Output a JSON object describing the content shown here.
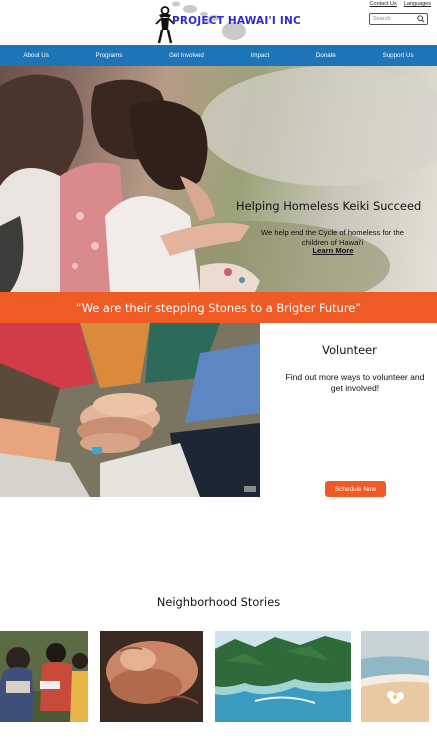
{
  "header": {
    "logo_text": "PROJECT HAWAI'I INC",
    "top_links": [
      "Contact Us",
      "Languages"
    ],
    "search_placeholder": "Search"
  },
  "nav": {
    "items": [
      "About Us",
      "Programs",
      "Get Involved",
      "Impact",
      "Donate",
      "Support Us"
    ]
  },
  "hero": {
    "title": "Helping Homeless Keiki Succeed",
    "subtitle": "We help end the Cycle of homeless for the children of Hawai'i",
    "link": "Learn More"
  },
  "banner": {
    "quote": "“We are their stepping Stones to a Brigter Future”"
  },
  "volunteer": {
    "title": "Volunteer",
    "text": "Find out more ways to volunteer and get involved!",
    "button": "Schedule Now"
  },
  "stories": {
    "title": "Neighborhood Stories"
  },
  "colors": {
    "nav_blue": "#1d74b6",
    "accent_orange": "#f05a24",
    "logo_blue": "#2b2bcf"
  }
}
